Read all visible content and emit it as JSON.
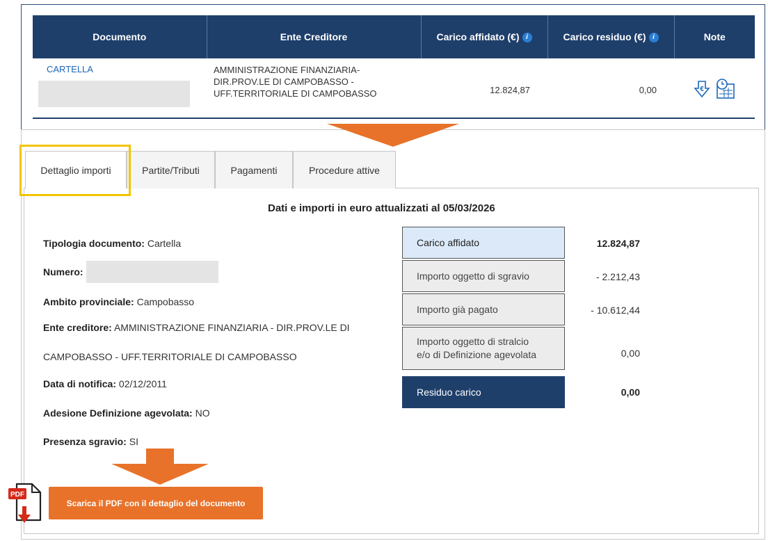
{
  "document_table": {
    "headers": {
      "documento": "Documento",
      "ente_creditore": "Ente Creditore",
      "carico_affidato": "Carico affidato (€)",
      "carico_residuo": "Carico residuo (€)",
      "note": "Note"
    },
    "row": {
      "documento": "CARTELLA",
      "ente_line1": "AMMINISTRAZIONE FINANZIARIA-",
      "ente_line2": "DIR.PROV.LE DI CAMPOBASSO -",
      "ente_line3": "UFF.TERRITORIALE DI CAMPOBASSO",
      "carico_affidato": "12.824,87",
      "carico_residuo": "0,00"
    }
  },
  "tabs": [
    {
      "label": "Dettaglio importi"
    },
    {
      "label": "Partite/Tributi"
    },
    {
      "label": "Pagamenti"
    },
    {
      "label": "Procedure attive"
    }
  ],
  "panel": {
    "title": "Dati e importi in euro attualizzati al 05/03/2026",
    "fields": {
      "tipologia_label": "Tipologia documento:",
      "tipologia_value": "Cartella",
      "numero_label": "Numero:",
      "ambito_label": "Ambito provinciale:",
      "ambito_value": "Campobasso",
      "ente_label": "Ente creditore:",
      "ente_value_line1": "AMMINISTRAZIONE FINANZIARIA - DIR.PROV.LE DI",
      "ente_value_line2": "CAMPOBASSO - UFF.TERRITORIALE DI CAMPOBASSO",
      "data_label": "Data di notifica:",
      "data_value": "02/12/2011",
      "adesione_label": "Adesione Definizione agevolata:",
      "adesione_value": "NO",
      "sgravio_label": "Presenza sgravio:",
      "sgravio_value": "SI"
    },
    "amounts": [
      {
        "label": "Carico affidato",
        "value": "12.824,87"
      },
      {
        "label": "Importo oggetto di sgravio",
        "value": "- 2.212,43"
      },
      {
        "label": "Importo già pagato",
        "value": "- 10.612,44"
      },
      {
        "label_line1": "Importo oggetto di stralcio",
        "label_line2": "e/o di Definizione agevolata",
        "value": "0,00"
      },
      {
        "label": "Residuo carico",
        "value": "0,00"
      }
    ]
  },
  "pdf_button": {
    "label": "Scarica il PDF con il dettaglio del documento",
    "icon_text": "PDF"
  },
  "colors": {
    "header_blue": "#1f3f6b",
    "accent_orange": "#e8722a",
    "highlight_yellow": "#f2c400",
    "light_blue_box": "#dbe9f8",
    "grey_box": "#ececec"
  }
}
